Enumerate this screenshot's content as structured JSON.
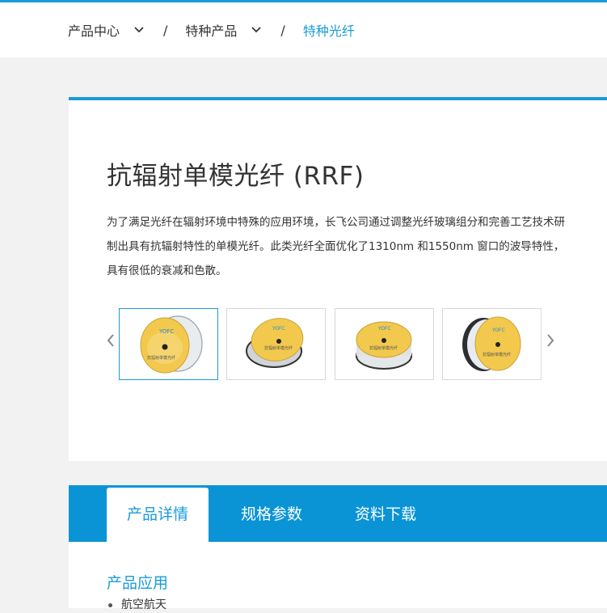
{
  "breadcrumb": {
    "items": [
      {
        "label": "产品中心"
      },
      {
        "label": "特种产品"
      }
    ],
    "separator": "/",
    "current": "特种光纤"
  },
  "product": {
    "title": "抗辐射单模光纤 (RRF)",
    "description": "为了满足光纤在辐射环境中特殊的应用环境，长飞公司通过调整光纤玻璃组分和完善工艺技术研制出具有抗辐射特性的单模光纤。此类光纤全面优化了1310nm 和1550nm 窗口的波导特性， 具有很低的衰减和色散。",
    "gallery": {
      "thumbnails": [
        {
          "label": "抗辐射单模光纤",
          "logo": "YOFC",
          "active": true
        },
        {
          "label": "抗辐射单模光纤",
          "logo": "YOFC",
          "active": false
        },
        {
          "label": "抗辐射单模光纤",
          "logo": "YOFC",
          "active": false
        },
        {
          "label": "抗辐射单模光纤",
          "logo": "YOFC",
          "active": false
        }
      ]
    }
  },
  "tabs": [
    {
      "label": "产品详情",
      "active": true
    },
    {
      "label": "规格参数",
      "active": false
    },
    {
      "label": "资料下载",
      "active": false
    }
  ],
  "details": {
    "section_title": "产品应用",
    "items": [
      "航空航天"
    ]
  },
  "colors": {
    "accent": "#1a9bd7",
    "tab_bar": "#0a94d6",
    "spool_label": "#f2c94c"
  },
  "icons": {
    "breadcrumb_dropdown": "chevron-down-icon",
    "gallery_prev": "chevron-left-icon",
    "gallery_next": "chevron-right-icon"
  }
}
